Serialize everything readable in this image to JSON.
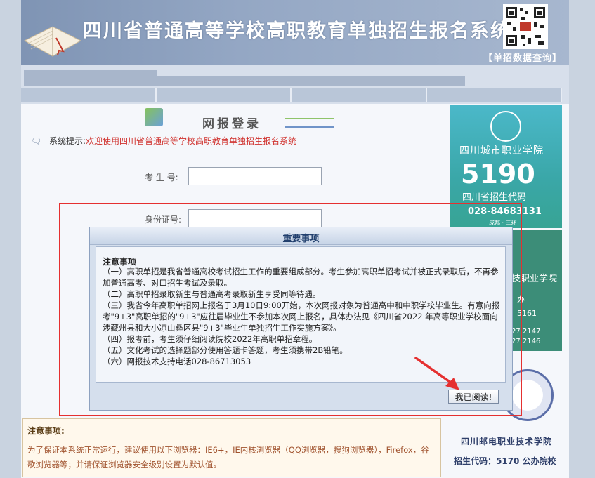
{
  "banner": {
    "title": "四川省普通高等学校高职教育单独招生报名系统",
    "query_link": "【单招数据查询】"
  },
  "login": {
    "heading": "网报登录",
    "hint_label": "系统提示:",
    "hint_message": "欢迎使用四川省普通高等学校高职教育单独招生报名系统",
    "exam_number_label": "考 生 号:",
    "exam_number_value": "",
    "id_number_label": "身份证号:",
    "id_number_value": ""
  },
  "notice_box": {
    "title": "注意事项:",
    "body": "为了保证本系统正常运行，建议使用以下浏览器：IE6+，IE内核浏览器（QQ浏览器，搜狗浏览器），Firefox，谷歌浏览器等；并请保证浏览器安全级别设置为默认值。"
  },
  "sidebar": {
    "ad1": {
      "name": "四川城市职业学院",
      "code": "5190",
      "code_label": "四川省招生代码",
      "phone": "028-84683131",
      "small": "成都 · 三环"
    },
    "ad2": {
      "name_fragment": "技职业学院",
      "fragment2": "办",
      "line1": "5161",
      "line2": "27 2147",
      "line3": "27 2146"
    },
    "ad3": {
      "name": "四川邮电职业技术学院",
      "code": "招生代码：5170 公办院校"
    }
  },
  "modal": {
    "header": "重要事项",
    "title": "注意事项",
    "lines": [
      "（一）高职单招是我省普通高校考试招生工作的重要组成部分。考生参加高职单招考试并被正式录取后，不再参加普通高考、对口招生考试及录取。",
      "（二）高职单招录取新生与普通高考录取新生享受同等待遇。",
      "（三）我省今年高职单招网上报名于3月10日9:00开始，本次网报对象为普通高中和中职学校毕业生。有意向报考\"9+3\"高职单招的\"9+3\"应往届毕业生不参加本次网上报名，具体办法见《四川省2022 年高等职业学校面向涉藏州县和大小凉山彝区县\"9+3\"毕业生单独招生工作实施方案》。",
      "（四）报考前，考生须仔细阅读院校2022年高职单招章程。",
      "（五）文化考试的选择题部分使用答题卡答题，考生须携带2B铅笔。",
      "（六）网报技术支持电话028-86713053"
    ],
    "button": "我已阅读!"
  },
  "colors": {
    "highlight": "#e53030",
    "accent": "#22406e"
  }
}
